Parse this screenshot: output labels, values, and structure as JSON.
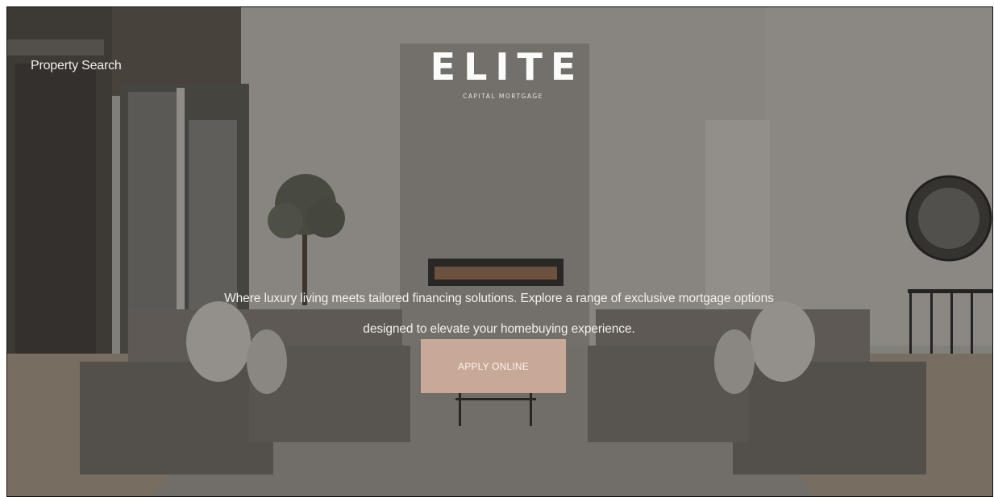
{
  "nav": {
    "property_search": "Property Search"
  },
  "logo": {
    "wordmark": "ELITE",
    "subtitle": "CAPITAL MORTGAGE"
  },
  "hero": {
    "tagline_line1": "Where luxury living meets tailored financing solutions. Explore a range of exclusive mortgage options",
    "tagline_line2": "designed to elevate your homebuying experience.",
    "cta_label": "APPLY ONLINE"
  },
  "colors": {
    "accent_button": "#c8a896",
    "text_light": "#f3f0ec"
  }
}
